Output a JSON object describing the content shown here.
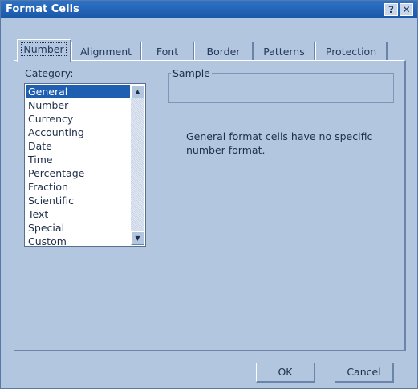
{
  "window": {
    "title": "Format Cells",
    "help_button": "?",
    "close_button": "✕"
  },
  "tabs": [
    "Number",
    "Alignment",
    "Font",
    "Border",
    "Patterns",
    "Protection"
  ],
  "category": {
    "label_underlined": "C",
    "label_rest": "ategory:",
    "items": [
      "General",
      "Number",
      "Currency",
      "Accounting",
      "Date",
      "Time",
      "Percentage",
      "Fraction",
      "Scientific",
      "Text",
      "Special",
      "Custom"
    ],
    "selected": "General"
  },
  "sample": {
    "label": "Sample",
    "value": ""
  },
  "description": "General format cells have no specific number format.",
  "buttons": {
    "ok": "OK",
    "cancel": "Cancel"
  },
  "colors": {
    "title_bar": "#1f61b5",
    "dialog_bg": "#b3c6e0",
    "selection": "#1f5fb2"
  }
}
